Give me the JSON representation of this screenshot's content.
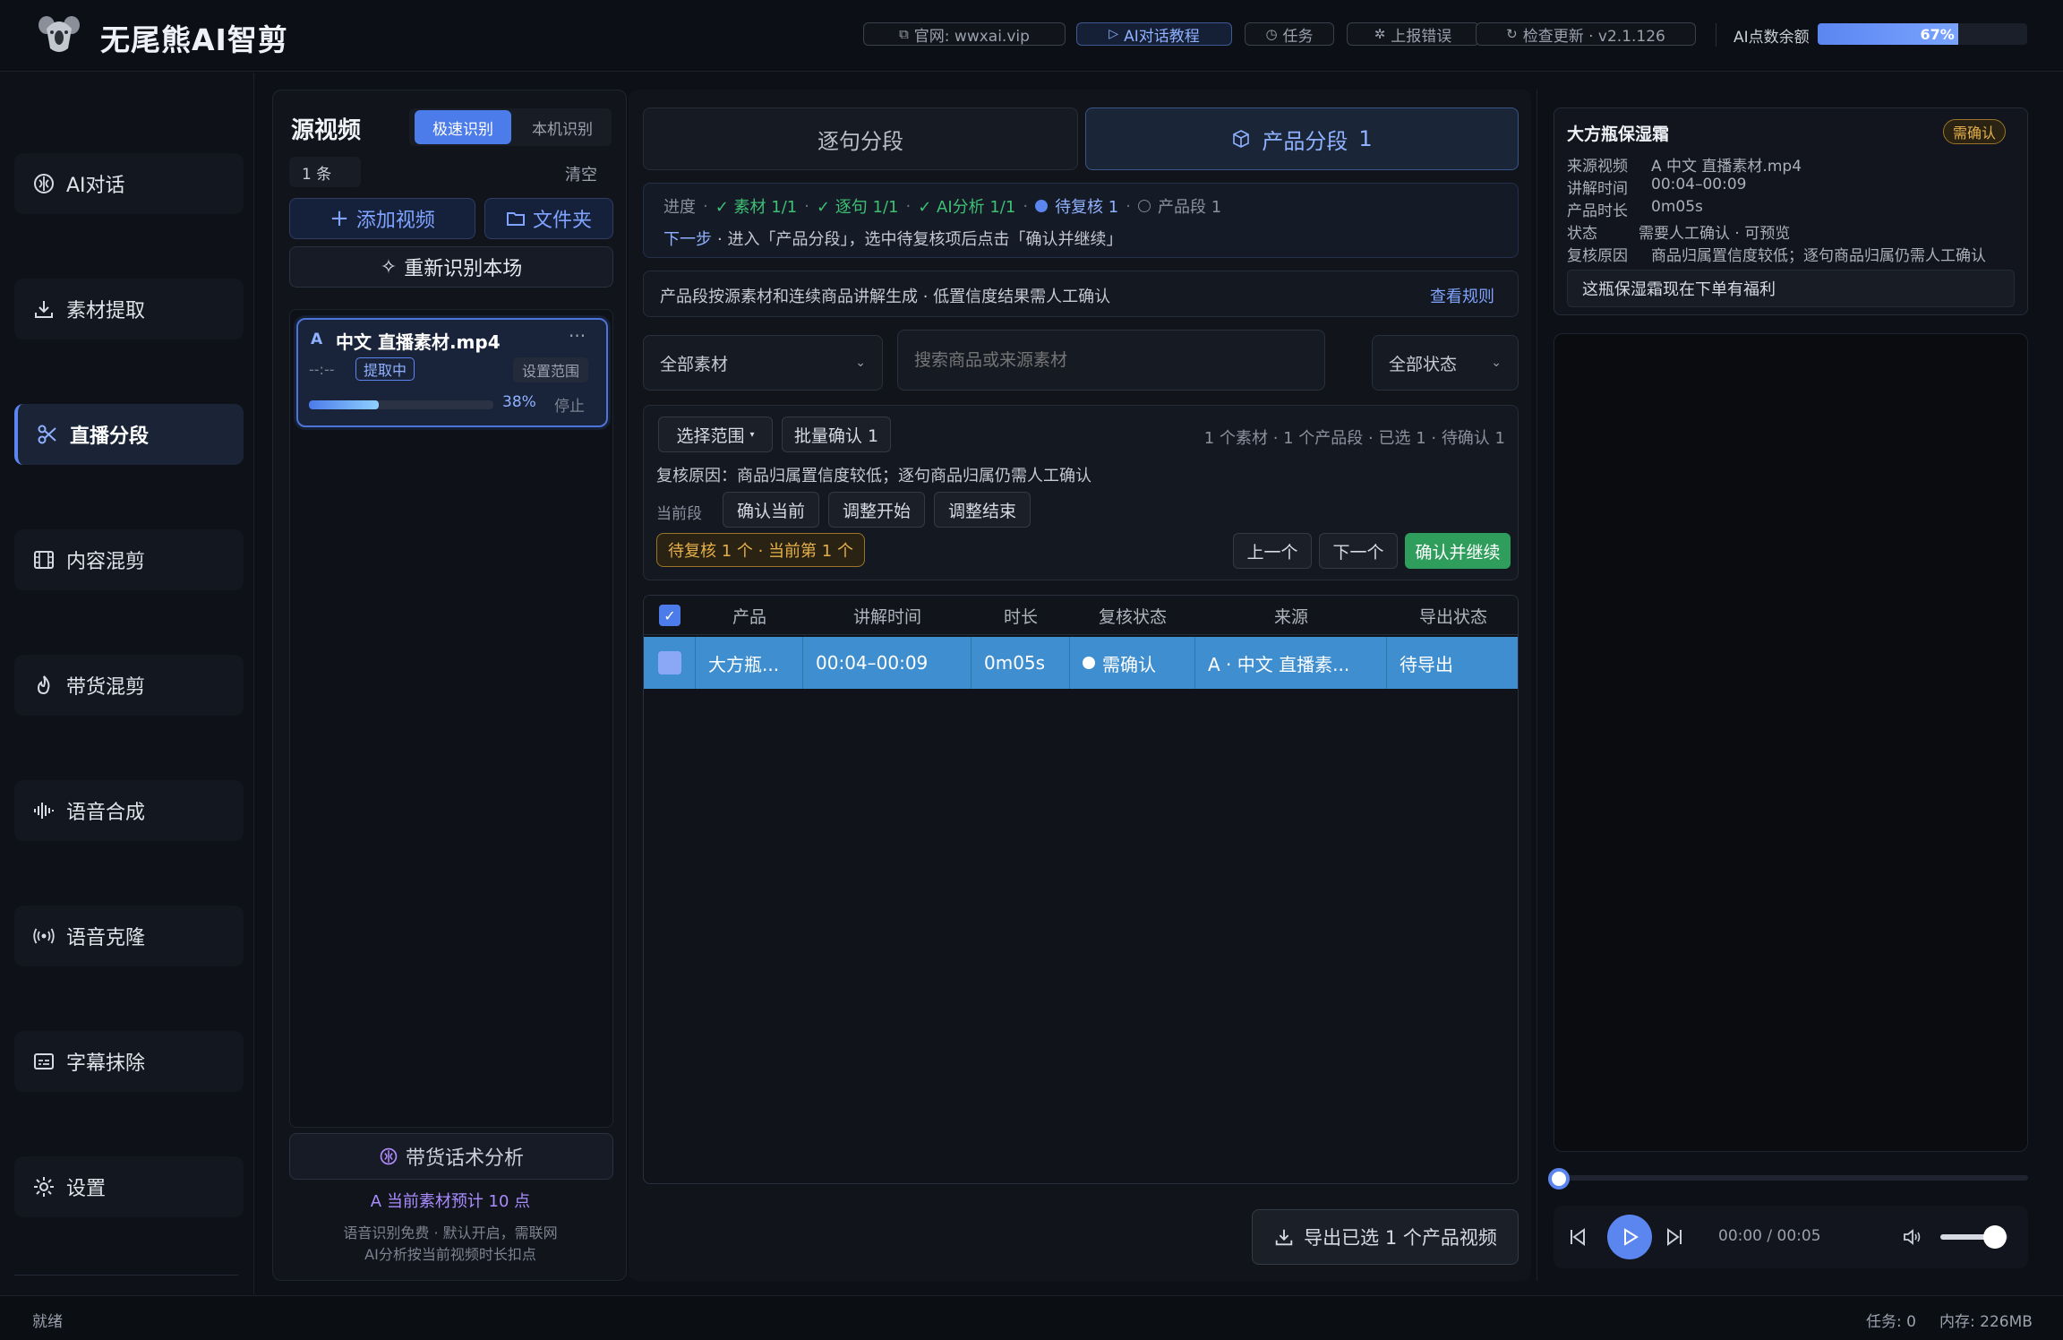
{
  "header": {
    "title": "无尾熊AI智剪",
    "buttons": {
      "site": "官网: wwxai.vip",
      "tutorial": "AI对话教程",
      "tasks": "任务",
      "report": "上报错误",
      "update": "检查更新 · v2.1.126"
    },
    "ai_label": "AI点数余额",
    "ai_percent_text": "67%",
    "ai_percent": 0.67
  },
  "sidebar": {
    "items": [
      {
        "label": "AI对话",
        "icon": "ai-chat-icon"
      },
      {
        "label": "素材提取",
        "icon": "download-icon"
      },
      {
        "label": "直播分段",
        "icon": "scissors-icon"
      },
      {
        "label": "内容混剪",
        "icon": "film-icon"
      },
      {
        "label": "带货混剪",
        "icon": "flame-icon"
      },
      {
        "label": "语音合成",
        "icon": "waveform-icon"
      },
      {
        "label": "语音克隆",
        "icon": "broadcast-icon"
      },
      {
        "label": "字幕抹除",
        "icon": "subtitle-icon"
      },
      {
        "label": "设置",
        "icon": "gear-icon"
      }
    ]
  },
  "source": {
    "title": "源视频",
    "mode_fast": "极速识别",
    "mode_local": "本机识别",
    "count": "1 条",
    "clear": "清空",
    "add_video": "添加视频",
    "folder": "文件夹",
    "rerecognize": "重新识别本场",
    "file": {
      "badge": "A",
      "name": "中文 直播素材.mp4",
      "more": "···",
      "time": "--:--",
      "status": "提取中",
      "range": "设置范围",
      "progress_text": "38%",
      "progress": 0.38,
      "stop": "停止"
    },
    "analysis": "带货话术分析",
    "estimate": "A 当前素材预计 10 点",
    "note1": "语音识别免费 · 默认开启，需联网",
    "note2": "AI分析按当前视频时长扣点"
  },
  "main": {
    "tab_sentence": "逐句分段",
    "tab_product": "产品分段",
    "tab_product_count": "1",
    "progress": {
      "label": "进度",
      "steps": [
        "✓ 素材 1/1",
        "✓ 逐句 1/1",
        "✓ AI分析 1/1"
      ],
      "pending": "待复核 1",
      "product": "产品段 1",
      "next_label": "下一步",
      "next_text": "· 进入「产品分段」，选中待复核项后点击「确认并继续」"
    },
    "info": "产品段按源素材和连续商品讲解生成 · 低置信度结果需人工确认",
    "rules": "查看规则",
    "filter_all": "全部素材",
    "search_placeholder": "搜索商品或来源素材",
    "status_all": "全部状态",
    "select_range": "选择范围",
    "batch_confirm": "批量确认 1",
    "summary": "1 个素材 · 1 个产品段 · 已选 1 · 待确认 1",
    "review_reason": "复核原因：商品归属置信度较低；逐句商品归属仍需人工确认",
    "current_label": "当前段",
    "confirm_current": "确认当前",
    "adjust_start": "调整开始",
    "adjust_end": "调整结束",
    "pending_badge": "待复核 1 个 · 当前第 1 个",
    "prev": "上一个",
    "next": "下一个",
    "confirm_continue": "确认并继续",
    "table": {
      "headers": [
        "产品",
        "讲解时间",
        "时长",
        "复核状态",
        "来源",
        "导出状态"
      ],
      "rows": [
        {
          "product": "大方瓶...",
          "time": "00:04–00:09",
          "duration": "0m05s",
          "review": "需确认",
          "source": "A · 中文 直播素...",
          "export": "待导出"
        }
      ]
    },
    "export_btn": "导出已选 1 个产品视频"
  },
  "detail": {
    "title": "大方瓶保湿霜",
    "badge": "需确认",
    "rows": [
      {
        "k": "来源视频",
        "v": "A  中文 直播素材.mp4"
      },
      {
        "k": "讲解时间",
        "v": "00:04–00:09"
      },
      {
        "k": "产品时长",
        "v": "0m05s"
      },
      {
        "k": "状态",
        "v": "需要人工确认 · 可预览"
      },
      {
        "k": "复核原因",
        "v": "商品归属置信度较低；逐句商品归属仍需人工确认"
      }
    ],
    "quote": "这瓶保湿霜现在下单有福利"
  },
  "player": {
    "time": "00:00 / 00:05",
    "seek": 0.0,
    "volume": 0.8
  },
  "statusbar": {
    "left": "就绪",
    "tasks": "任务: 0",
    "memory": "内存: 226MB"
  },
  "colors": {
    "accent": "#4c7bea",
    "success": "#2f9e5c",
    "row_selected": "#3f8fd0",
    "warning": "#d9a23a"
  }
}
